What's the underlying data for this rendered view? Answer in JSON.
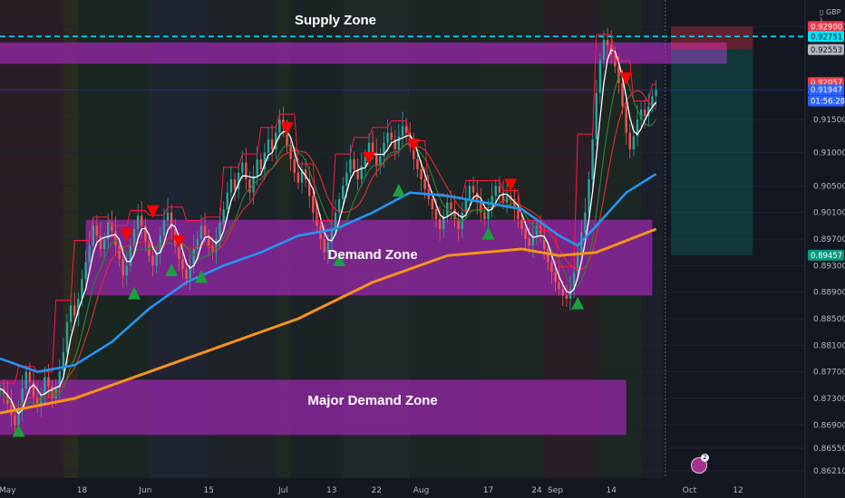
{
  "header": {
    "currency": "GBP"
  },
  "zones": [
    {
      "label": "Supply Zone",
      "low": 0.9234,
      "high": 0.9266,
      "from": 0,
      "to": 195,
      "label_price": 0.9298,
      "label_idx": 90
    },
    {
      "label": "Demand Zone",
      "low": 0.8885,
      "high": 0.8999,
      "from": 23,
      "to": 175,
      "label_price": 0.8945,
      "label_idx": 100
    },
    {
      "label": "Major Demand Zone",
      "low": 0.8675,
      "high": 0.8758,
      "from": 0,
      "to": 168,
      "label_price": 0.8726,
      "label_idx": 100
    }
  ],
  "chart_data": {
    "type": "candlestick",
    "title": "",
    "xlabel": "",
    "ylabel": "GBP",
    "ylim": [
      0.861,
      0.933
    ],
    "xlim_index": [
      0,
      216
    ],
    "price_ticks": [
      0.929,
      0.9275,
      0.92553,
      0.92057,
      0.91947,
      0.915,
      0.91,
      0.905,
      0.901,
      0.897,
      0.89457,
      0.893,
      0.889,
      0.885,
      0.881,
      0.877,
      0.873,
      0.869,
      0.8655,
      0.8621
    ],
    "plain_price_ticks": [
      0.929,
      0.915,
      0.91,
      0.905,
      0.901,
      0.897,
      0.893,
      0.889,
      0.885,
      0.881,
      0.877,
      0.873,
      0.869,
      0.8655,
      0.8621
    ],
    "date_ticks": [
      {
        "label": "May",
        "index": 2
      },
      {
        "label": "18",
        "index": 22
      },
      {
        "label": "Jun",
        "index": 39
      },
      {
        "label": "15",
        "index": 56
      },
      {
        "label": "Jul",
        "index": 76
      },
      {
        "label": "13",
        "index": 89
      },
      {
        "label": "22",
        "index": 101
      },
      {
        "label": "Aug",
        "index": 113
      },
      {
        "label": "17",
        "index": 131
      },
      {
        "label": "24",
        "index": 144
      },
      {
        "label": "Sep",
        "index": 149
      },
      {
        "label": "14",
        "index": 164
      },
      {
        "label": "Oct",
        "index": 185
      },
      {
        "label": "12",
        "index": 198
      }
    ],
    "price_tags": [
      {
        "label": "0.92900",
        "price": 0.929,
        "bg": "#f23645",
        "fg": "#ffffff"
      },
      {
        "label": "0.92751",
        "price": 0.92751,
        "bg": "#00e5ff",
        "fg": "#131722"
      },
      {
        "label": "0.92553",
        "price": 0.92553,
        "bg": "#b2b5be",
        "fg": "#131722"
      },
      {
        "label": "0.92057",
        "price": 0.92057,
        "bg": "#f23645",
        "fg": "#ffffff"
      },
      {
        "label": "0.91947",
        "price": 0.91947,
        "bg": "#2962ff",
        "fg": "#ffffff"
      },
      {
        "label": "01:56:28",
        "price": 0.9178,
        "bg": "#2962ff",
        "fg": "#ffffff"
      },
      {
        "label": "0.89457",
        "price": 0.89457,
        "bg": "#089981",
        "fg": "#ffffff"
      }
    ],
    "position_box": {
      "from": 180,
      "to": 202,
      "entry": 0.92553,
      "stop": 0.929,
      "target": 0.89457
    },
    "resistance_line": 0.92751,
    "series_closes": [
      0.8745,
      0.8738,
      0.8722,
      0.8705,
      0.869,
      0.8712,
      0.8745,
      0.877,
      0.8755,
      0.8732,
      0.8718,
      0.8735,
      0.8762,
      0.8748,
      0.873,
      0.8745,
      0.8771,
      0.88,
      0.8845,
      0.887,
      0.8855,
      0.888,
      0.891,
      0.8935,
      0.896,
      0.899,
      0.8975,
      0.8955,
      0.897,
      0.8995,
      0.8982,
      0.896,
      0.894,
      0.8915,
      0.893,
      0.896,
      0.8985,
      0.9005,
      0.899,
      0.8965,
      0.8945,
      0.893,
      0.895,
      0.8975,
      0.8998,
      0.901,
      0.8985,
      0.896,
      0.894,
      0.8925,
      0.891,
      0.893,
      0.8955,
      0.897,
      0.899,
      0.8975,
      0.896,
      0.895,
      0.897,
      0.8995,
      0.9015,
      0.904,
      0.906,
      0.9045,
      0.907,
      0.9085,
      0.906,
      0.904,
      0.9065,
      0.909,
      0.9075,
      0.91,
      0.912,
      0.9105,
      0.913,
      0.915,
      0.914,
      0.911,
      0.909,
      0.907,
      0.9055,
      0.9075,
      0.906,
      0.9035,
      0.901,
      0.899,
      0.897,
      0.895,
      0.8965,
      0.8985,
      0.901,
      0.903,
      0.905,
      0.907,
      0.909,
      0.9075,
      0.906,
      0.908,
      0.9095,
      0.9115,
      0.91,
      0.908,
      0.9095,
      0.9115,
      0.913,
      0.912,
      0.9105,
      0.9125,
      0.914,
      0.913,
      0.911,
      0.909,
      0.9075,
      0.906,
      0.9045,
      0.903,
      0.9015,
      0.9,
      0.8985,
      0.9005,
      0.9025,
      0.9015,
      0.9,
      0.8985,
      0.901,
      0.903,
      0.905,
      0.904,
      0.9025,
      0.901,
      0.9,
      0.9015,
      0.9035,
      0.905,
      0.904,
      0.9025,
      0.9035,
      0.903,
      0.9015,
      0.9,
      0.8985,
      0.897,
      0.896,
      0.8975,
      0.899,
      0.8975,
      0.8955,
      0.8935,
      0.892,
      0.8905,
      0.8895,
      0.8885,
      0.888,
      0.8895,
      0.892,
      0.895,
      0.898,
      0.901,
      0.906,
      0.912,
      0.919,
      0.924,
      0.927,
      0.9262,
      0.9248,
      0.923,
      0.9205,
      0.917,
      0.913,
      0.9105,
      0.9125,
      0.915,
      0.9165,
      0.9155,
      0.917,
      0.9185,
      0.9195
    ],
    "ma_slow": {
      "name": "",
      "color": "#f7931a",
      "x": [
        0,
        20,
        40,
        60,
        80,
        100,
        120,
        140,
        150,
        160,
        176
      ],
      "y": [
        0.8708,
        0.873,
        0.877,
        0.881,
        0.885,
        0.8905,
        0.8945,
        0.8955,
        0.8945,
        0.895,
        0.8985
      ]
    },
    "ma_mid": {
      "name": "",
      "color": "#2196f3",
      "x": [
        0,
        10,
        20,
        30,
        40,
        50,
        60,
        70,
        80,
        90,
        100,
        110,
        120,
        130,
        140,
        150,
        155,
        160,
        168,
        176
      ],
      "y": [
        0.879,
        0.877,
        0.878,
        0.8815,
        0.8865,
        0.8905,
        0.893,
        0.895,
        0.8975,
        0.8985,
        0.901,
        0.904,
        0.9035,
        0.9025,
        0.9015,
        0.8975,
        0.896,
        0.899,
        0.904,
        0.9068
      ]
    },
    "markers": [
      {
        "type": "sell",
        "index": 34,
        "price": 0.8975
      },
      {
        "type": "sell",
        "index": 41,
        "price": 0.901
      },
      {
        "type": "sell",
        "index": 48,
        "price": 0.8965
      },
      {
        "type": "sell",
        "index": 77,
        "price": 0.9135
      },
      {
        "type": "sell",
        "index": 99,
        "price": 0.909
      },
      {
        "type": "sell",
        "index": 111,
        "price": 0.911
      },
      {
        "type": "sell",
        "index": 137,
        "price": 0.905
      },
      {
        "type": "sell",
        "index": 168,
        "price": 0.921
      },
      {
        "type": "buy",
        "index": 5,
        "price": 0.8683
      },
      {
        "type": "buy",
        "index": 36,
        "price": 0.889
      },
      {
        "type": "buy",
        "index": 46,
        "price": 0.8925
      },
      {
        "type": "buy",
        "index": 54,
        "price": 0.8915
      },
      {
        "type": "buy",
        "index": 91,
        "price": 0.894
      },
      {
        "type": "buy",
        "index": 107,
        "price": 0.9045
      },
      {
        "type": "buy",
        "index": 131,
        "price": 0.898
      },
      {
        "type": "buy",
        "index": 155,
        "price": 0.8875
      }
    ]
  },
  "footer": {
    "avatar_badge": "2"
  }
}
